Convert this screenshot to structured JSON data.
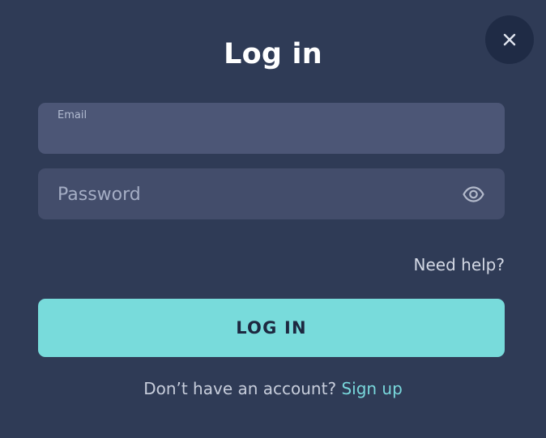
{
  "dialog": {
    "title": "Log in",
    "close_icon": "close-icon"
  },
  "email": {
    "label": "Email",
    "value": ""
  },
  "password": {
    "placeholder": "Password",
    "value": "",
    "toggle_icon": "eye-icon"
  },
  "links": {
    "need_help": "Need help?",
    "no_account": "Don’t have an account?",
    "sign_up": "Sign up"
  },
  "buttons": {
    "login": "LOG IN"
  },
  "colors": {
    "background": "#2f3b56",
    "accent": "#78dbdb",
    "field": "#4c5676"
  }
}
